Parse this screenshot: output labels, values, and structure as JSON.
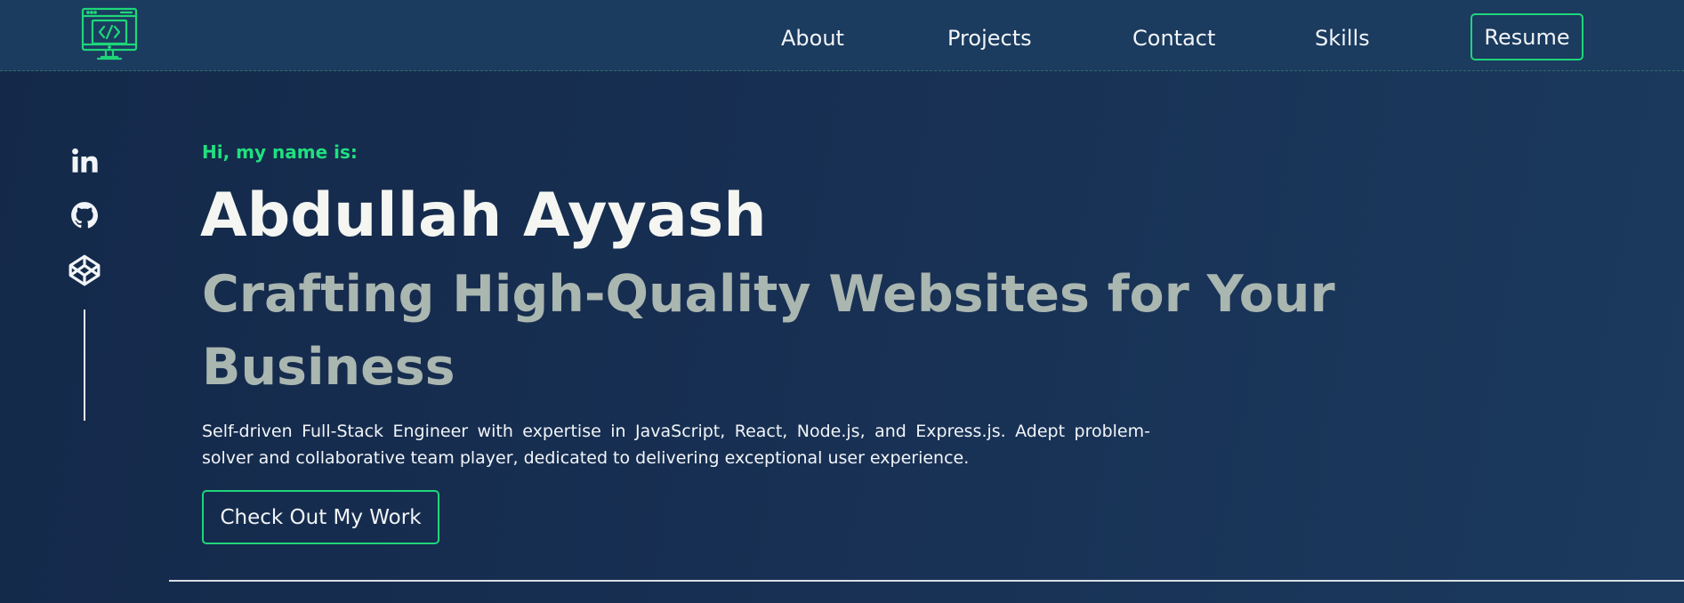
{
  "header": {
    "logo": "code-monitor-icon",
    "nav": [
      {
        "label": "About"
      },
      {
        "label": "Projects"
      },
      {
        "label": "Contact"
      },
      {
        "label": "Skills"
      }
    ],
    "resume_label": "Resume"
  },
  "social": [
    {
      "icon": "linkedin-icon"
    },
    {
      "icon": "github-icon"
    },
    {
      "icon": "codepen-icon"
    }
  ],
  "hero": {
    "greeting": "Hi, my name is:",
    "name": "Abdullah Ayyash",
    "tagline": "Crafting High-Quality Websites for Your Business",
    "description": "Self-driven Full-Stack Engineer with expertise in JavaScript, React, Node.js, and Express.js. Adept problem-solver and collaborative team player, dedicated to delivering exceptional user experience.",
    "cta_label": "Check Out My Work"
  },
  "colors": {
    "accent": "#1fd679",
    "background": "#172f52",
    "header": "#1b3b5f",
    "tagline": "#aab6b0"
  }
}
